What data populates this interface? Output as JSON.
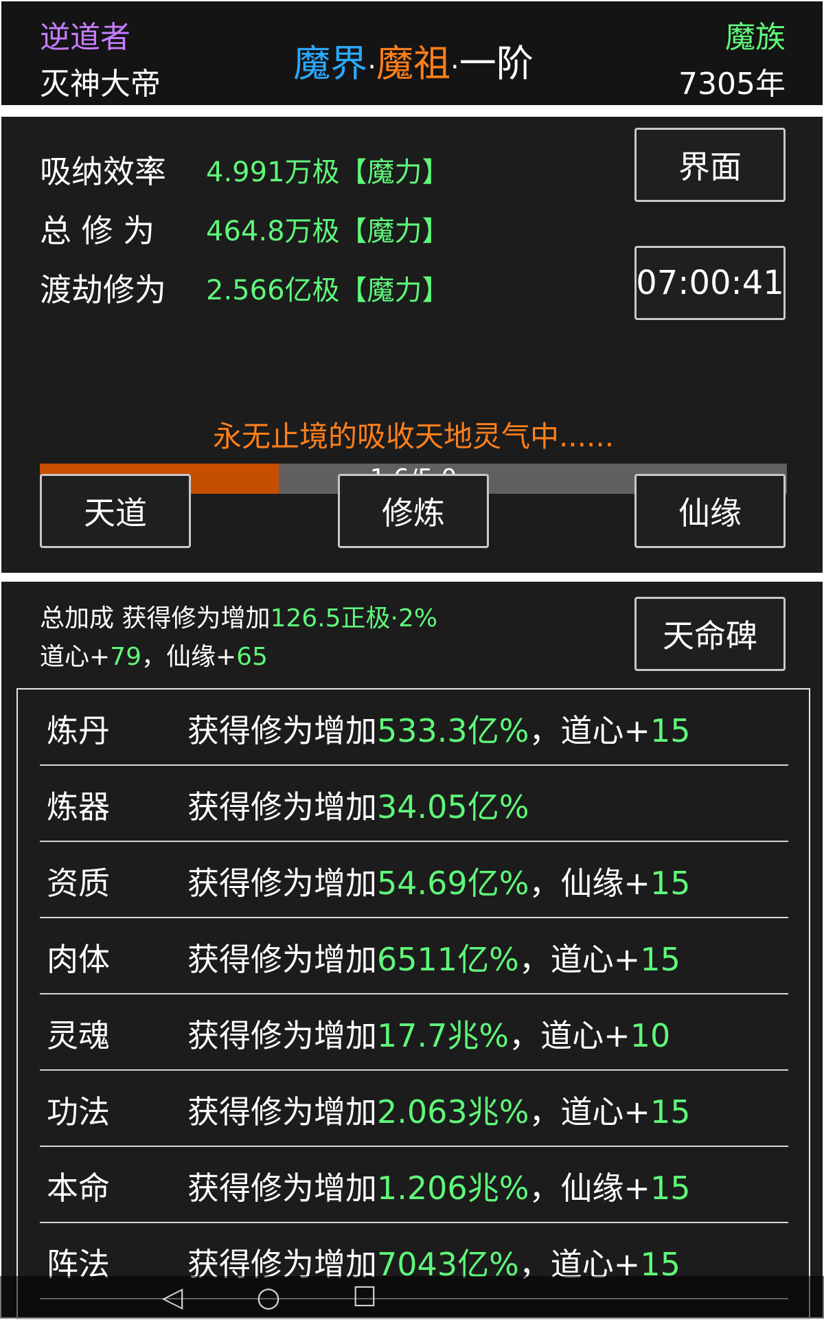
{
  "header": {
    "title_tag": "逆道者",
    "player_name": "灭神大帝",
    "realm": {
      "part1": "魔界",
      "sep1": "·",
      "part2": "魔祖",
      "sep2": "·",
      "part3": "一阶"
    },
    "race": "魔族",
    "age": "7305年"
  },
  "stats": [
    {
      "label": "吸纳效率",
      "value": "4.991万极【魔力】"
    },
    {
      "label": "总 修 为",
      "value": "464.8万极【魔力】"
    },
    {
      "label": "渡劫修为",
      "value": "2.566亿极【魔力】"
    }
  ],
  "buttons": {
    "interface": "界面",
    "timer": "07:00:41",
    "heaven": "天道",
    "cultivate": "修炼",
    "fate": "仙缘",
    "destiny_stele": "天命碑"
  },
  "progress": {
    "text": "1.6/5.0",
    "fraction": 0.32
  },
  "status_message": "永无止境的吸收天地灵气中......",
  "bonus_summary": {
    "line1_label": "总加成 获得修为增加",
    "line1_value": "126.5正极·2%",
    "l2_a": "道心+",
    "l2_b": "79",
    "l2_c": "，仙缘+",
    "l2_d": "65"
  },
  "bonus_rows": [
    {
      "name": "炼丹",
      "prefix": "获得修为增加",
      "value": "533.3亿%",
      "sep": "，道心+",
      "bonus": "15"
    },
    {
      "name": "炼器",
      "prefix": "获得修为增加",
      "value": "34.05亿%",
      "sep": "",
      "bonus": ""
    },
    {
      "name": "资质",
      "prefix": "获得修为增加",
      "value": "54.69亿%",
      "sep": "，仙缘+",
      "bonus": "15"
    },
    {
      "name": "肉体",
      "prefix": "获得修为增加",
      "value": "6511亿%",
      "sep": "，道心+",
      "bonus": "15"
    },
    {
      "name": "灵魂",
      "prefix": "获得修为增加",
      "value": "17.7兆%",
      "sep": "，道心+",
      "bonus": "10"
    },
    {
      "name": "功法",
      "prefix": "获得修为增加",
      "value": "2.063兆%",
      "sep": "，道心+",
      "bonus": "15"
    },
    {
      "name": "本命",
      "prefix": "获得修为增加",
      "value": "1.206兆%",
      "sep": "，仙缘+",
      "bonus": "15"
    },
    {
      "name": "阵法",
      "prefix": "获得修为增加",
      "value": "7043亿%",
      "sep": "，道心+",
      "bonus": "15"
    }
  ],
  "navbar": {
    "back_icon": "◁",
    "home_icon": "○",
    "recents_icon": "☐"
  },
  "colors": {
    "accent_green": "#5ff87a",
    "purple": "#c77dff",
    "cyan": "#2aa9ff",
    "orange": "#ff7f1a",
    "progress_fill": "#c64e00"
  }
}
